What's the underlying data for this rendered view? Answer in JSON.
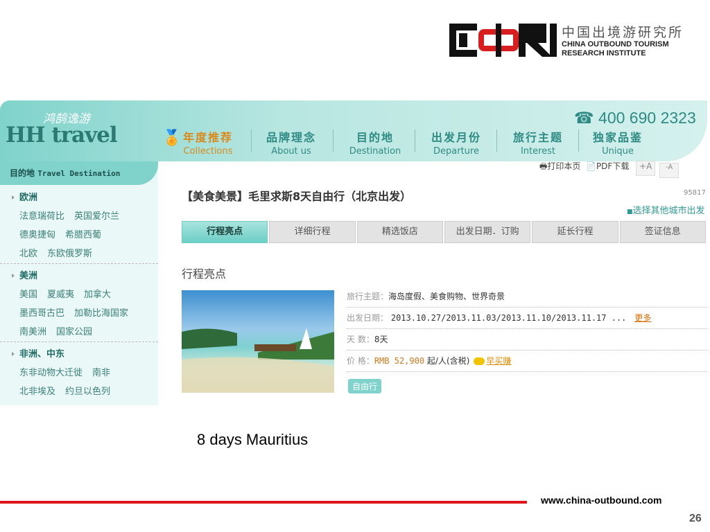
{
  "logo": {
    "cn": "中国出境游研究所",
    "en1": "CHINA OUTBOUND TOURISM",
    "en2": "RESEARCH INSTITUTE"
  },
  "site": {
    "brand_cn": "鸿鹄逸游",
    "brand_en": "HH travel",
    "phone": "400 690 2323",
    "nav": [
      {
        "cn": "年度推荐",
        "en": "Collections"
      },
      {
        "cn": "品牌理念",
        "en": "About us"
      },
      {
        "cn": "目的地",
        "en": "Destination"
      },
      {
        "cn": "出发月份",
        "en": "Departure"
      },
      {
        "cn": "旅行主题",
        "en": "Interest"
      },
      {
        "cn": "独家品鉴",
        "en": "Unique"
      }
    ]
  },
  "sidebar": {
    "title_cn": "目的地",
    "title_en": "Travel Destination",
    "regions": [
      {
        "title": "欧洲",
        "rows": [
          [
            "法意瑞荷比",
            "英国爱尔兰"
          ],
          [
            "德奥捷匈",
            "希腊西葡"
          ],
          [
            "北欧",
            "东欧俄罗斯"
          ]
        ]
      },
      {
        "title": "美洲",
        "rows": [
          [
            "美国",
            "夏威夷",
            "加拿大"
          ],
          [
            "墨西哥古巴",
            "加勒比海国家"
          ],
          [
            "南美洲",
            "国家公园"
          ]
        ]
      },
      {
        "title": "非洲、中东",
        "rows": [
          [
            "东非动物大迁徙",
            "南非"
          ],
          [
            "北非埃及",
            "约旦以色列"
          ]
        ]
      }
    ]
  },
  "tools": {
    "print": "打印本页",
    "pdf": "PDF下载",
    "font_up": "+A",
    "font_down": "-A"
  },
  "product": {
    "title": "【美食美景】毛里求斯8天自由行（北京出发）",
    "code": "95817",
    "other_city": "选择其他城市出发",
    "tabs": [
      "行程亮点",
      "详细行程",
      "精选饭店",
      "出发日期．订购",
      "延长行程",
      "签证信息"
    ],
    "section": "行程亮点",
    "theme_label": "旅行主题：",
    "theme": "海岛度假、美食购物、世界奇景",
    "date_label": "出发日期：",
    "dates": "2013.10.27/2013.11.03/2013.11.10/2013.11.17 ...",
    "more": "更多",
    "days_label": "天 数：",
    "days": "8天",
    "price_label": "价 格：",
    "price": "RMB 52,900",
    "price_unit": "起/人(含税)",
    "early": "早买赚",
    "tag": "自由行"
  },
  "caption": "8 days Mauritius",
  "footer": {
    "url": "www.china-outbound.com",
    "page": "26"
  },
  "colors": {
    "teal": "#7fd3cb",
    "red": "#e0141b"
  }
}
